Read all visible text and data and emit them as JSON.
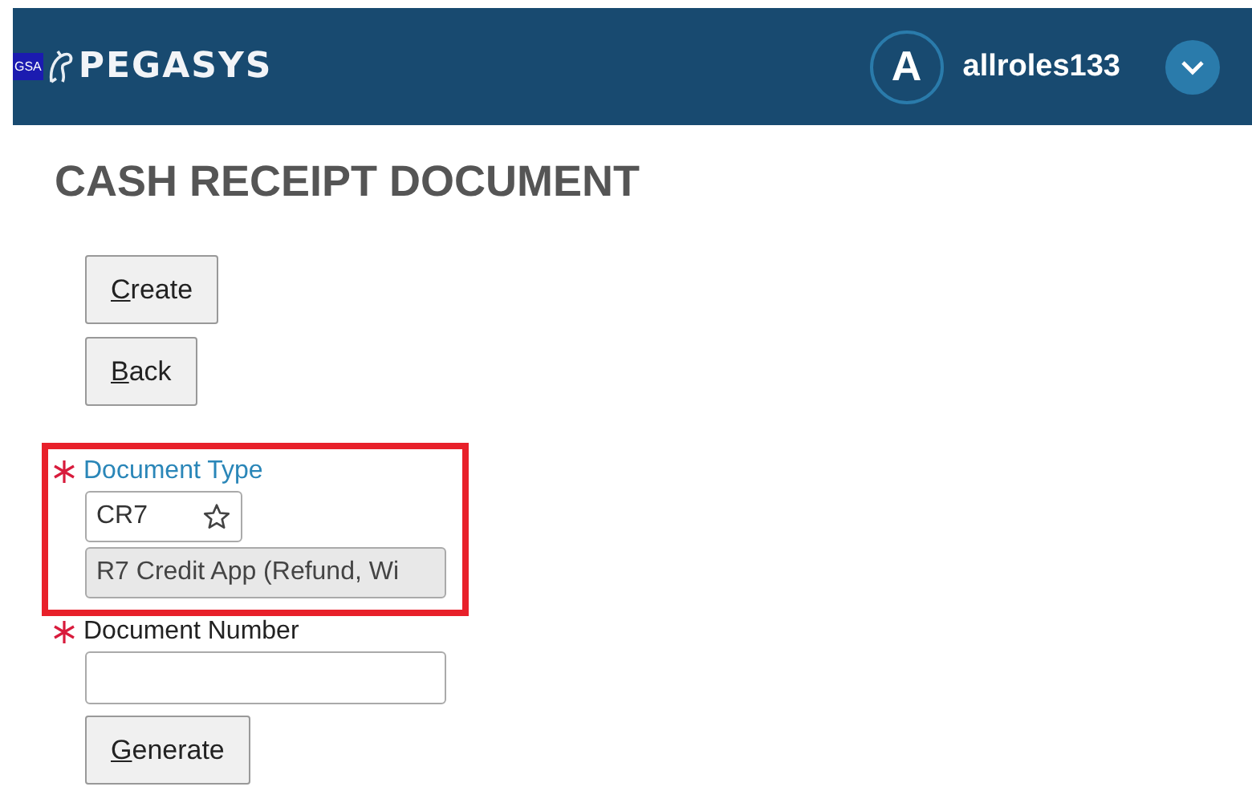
{
  "header": {
    "badge": "GSA",
    "brand": "PEGASYS",
    "avatar_letter": "A",
    "username": "allroles133"
  },
  "page_title": "CASH RECEIPT DOCUMENT",
  "actions": [
    {
      "label": "Create"
    },
    {
      "label": "Back"
    }
  ],
  "fields": [
    {
      "label": "Document Type",
      "required": true,
      "highlighted": true,
      "kind": "lookup",
      "value": "CR7",
      "description": "R7 Credit App (Refund, Wi"
    },
    {
      "label": "Document Number",
      "required": true,
      "highlighted": false,
      "kind": "text",
      "button": "Generate"
    }
  ]
}
